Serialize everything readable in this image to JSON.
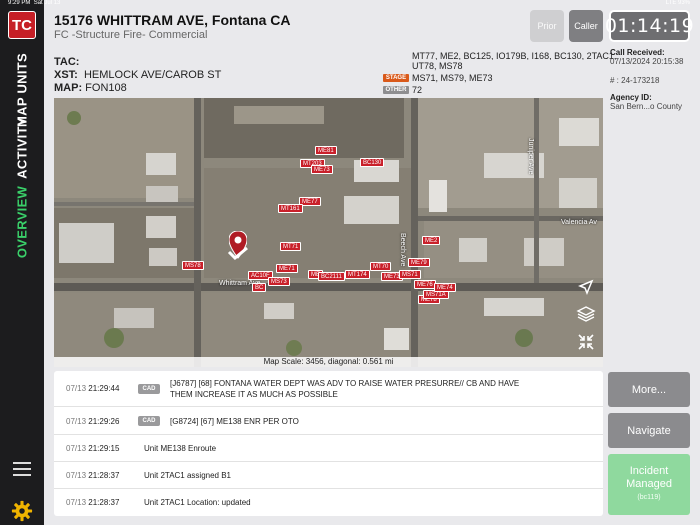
{
  "status_bar": {
    "time": "9:29 PM",
    "date": "Sat Jul 13",
    "signal": "LTE 93%"
  },
  "sidebar": {
    "logo": "TC",
    "tabs": [
      {
        "label": "MAP UNITS",
        "active": false
      },
      {
        "label": "ACTIVITY",
        "active": false
      },
      {
        "label": "OVERVIEW",
        "active": true
      }
    ]
  },
  "header": {
    "address": "15176 WHITTRAM AVE, Fontana CA",
    "call_type": "FC -Structure Fire- Commercial",
    "prior_label": "Prior",
    "caller_label": "Caller",
    "timer": "01:14:19"
  },
  "info": {
    "tac_label": "TAC:",
    "tac_value": "",
    "xst_label": "XST:",
    "xst_value": "HEMLOCK AVE/CAROB ST",
    "map_label": "MAP:",
    "map_value": "FON108",
    "units_line1": "MT77, ME2, BC125, IO179B, I168, BC130, 2TAC1,",
    "units_line2": "UT78, MS78",
    "stage_badge": "STAGE",
    "stage_units": "MS71, MS79, ME73",
    "other_badge": "OTHER",
    "other_value": "72"
  },
  "call_info": {
    "received_label": "Call Received:",
    "received_value": "07/13/2024 20:15:38",
    "number_label": "# :",
    "number_value": "24-173218",
    "agency_label": "Agency ID:",
    "agency_value": "San Bern...o County"
  },
  "map": {
    "scale_text": "Map Scale: 3456, diagonal: 0.561 mi",
    "streets": [
      "Whittram Ave",
      "Beech Ave",
      "Valencia Av",
      "Juniper Ave"
    ],
    "units": [
      "ME81",
      "BC130",
      "MT203",
      "ME73",
      "ME77",
      "MT161",
      "ME2",
      "MT71",
      "ME79",
      "MS78",
      "ME71",
      "AC10F",
      "BC",
      "MS73",
      "ME",
      "BC2111",
      "MT174",
      "ME73",
      "MS71",
      "ME76",
      "ME78",
      "MT70",
      "MS71A",
      "ME74"
    ]
  },
  "activity": [
    {
      "date": "07/13",
      "time": "21:29:44",
      "badge": "CAD",
      "text": "[J6787] [68] FONTANA WATER DEPT WAS ADV TO RAISE WATER PRESURRE// CB AND HAVE THEM INCREASE IT AS MUCH AS POSSIBLE"
    },
    {
      "date": "07/13",
      "time": "21:29:26",
      "badge": "CAD",
      "text": "[G8724] [67] ME138  ENR PER OTO"
    },
    {
      "date": "07/13",
      "time": "21:29:15",
      "badge": "",
      "text": "Unit ME138 Enroute"
    },
    {
      "date": "07/13",
      "time": "21:28:37",
      "badge": "",
      "text": "Unit 2TAC1 assigned B1"
    },
    {
      "date": "07/13",
      "time": "21:28:37",
      "badge": "",
      "text": "Unit 2TAC1 Location: updated"
    }
  ],
  "actions": {
    "more_label": "More...",
    "navigate_label": "Navigate",
    "incident_label": "Incident Managed",
    "incident_sub": "(bc119)"
  },
  "colors": {
    "active_tab": "#3ad16a",
    "logo": "#c61f26",
    "stage": "#d9591a",
    "incident": "#8fd99e",
    "unit_marker": "#c9202a"
  }
}
